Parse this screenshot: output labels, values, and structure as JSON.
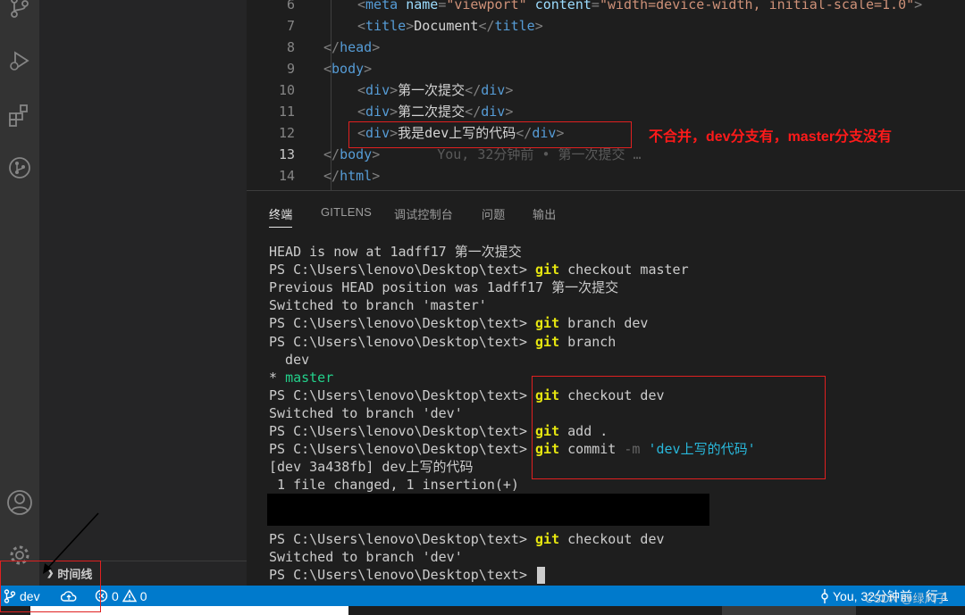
{
  "editor": {
    "lines": [
      {
        "num": "6",
        "parts": [
          [
            "pun",
            "<"
          ],
          [
            "tag",
            "meta "
          ],
          [
            "attr",
            "name"
          ],
          [
            "pun",
            "="
          ],
          [
            "str",
            "\"viewport\""
          ],
          [
            "txt",
            " "
          ],
          [
            "attr",
            "content"
          ],
          [
            "pun",
            "="
          ],
          [
            "str",
            "\"width=device-width, initial-scale=1.0\""
          ],
          [
            "pun",
            ">"
          ]
        ],
        "indent": 2
      },
      {
        "num": "7",
        "parts": [
          [
            "pun",
            "<"
          ],
          [
            "tag",
            "title"
          ],
          [
            "pun",
            ">"
          ],
          [
            "txt",
            "Document"
          ],
          [
            "pun",
            "</"
          ],
          [
            "tag",
            "title"
          ],
          [
            "pun",
            ">"
          ]
        ],
        "indent": 2
      },
      {
        "num": "8",
        "parts": [
          [
            "pun",
            "</"
          ],
          [
            "tag",
            "head"
          ],
          [
            "pun",
            ">"
          ]
        ],
        "indent": 1
      },
      {
        "num": "9",
        "parts": [
          [
            "pun",
            "<"
          ],
          [
            "tag",
            "body"
          ],
          [
            "pun",
            ">"
          ]
        ],
        "indent": 1
      },
      {
        "num": "10",
        "parts": [
          [
            "pun",
            "<"
          ],
          [
            "tag",
            "div"
          ],
          [
            "pun",
            ">"
          ],
          [
            "txt",
            "第一次提交"
          ],
          [
            "pun",
            "</"
          ],
          [
            "tag",
            "div"
          ],
          [
            "pun",
            ">"
          ]
        ],
        "indent": 2
      },
      {
        "num": "11",
        "parts": [
          [
            "pun",
            "<"
          ],
          [
            "tag",
            "div"
          ],
          [
            "pun",
            ">"
          ],
          [
            "txt",
            "第二次提交"
          ],
          [
            "pun",
            "</"
          ],
          [
            "tag",
            "div"
          ],
          [
            "pun",
            ">"
          ]
        ],
        "indent": 2
      },
      {
        "num": "12",
        "parts": [
          [
            "pun",
            "<"
          ],
          [
            "tag",
            "div"
          ],
          [
            "pun",
            ">"
          ],
          [
            "txt",
            "我是dev上写的代码"
          ],
          [
            "pun",
            "</"
          ],
          [
            "tag",
            "div"
          ],
          [
            "pun",
            ">"
          ]
        ],
        "indent": 2
      },
      {
        "num": "13",
        "parts": [
          [
            "pun",
            "</"
          ],
          [
            "tag",
            "body"
          ],
          [
            "pun",
            ">"
          ]
        ],
        "indent": 1,
        "blame": "You, 32分钟前 • 第一次提交 …"
      },
      {
        "num": "14",
        "parts": [
          [
            "pun",
            "</"
          ],
          [
            "tag",
            "html"
          ],
          [
            "pun",
            ">"
          ]
        ],
        "indent": 1
      }
    ]
  },
  "panel": {
    "tabs": [
      "终端",
      "GITLENS",
      "调试控制台",
      "问题",
      "输出"
    ],
    "active_tab": "终端",
    "prompt": "PS C:\\Users\\lenovo\\Desktop\\text> ",
    "terminal": [
      {
        "segs": [
          [
            "",
            "HEAD is now at 1adff17 第一次提交"
          ]
        ]
      },
      {
        "segs": [
          [
            "",
            "PS C:\\Users\\lenovo\\Desktop\\text> "
          ],
          [
            "gy",
            "git"
          ],
          [
            "",
            " checkout master"
          ]
        ]
      },
      {
        "segs": [
          [
            "",
            "Previous HEAD position was 1adff17 第一次提交"
          ]
        ]
      },
      {
        "segs": [
          [
            "",
            "Switched to branch 'master'"
          ]
        ]
      },
      {
        "segs": [
          [
            "",
            "PS C:\\Users\\lenovo\\Desktop\\text> "
          ],
          [
            "gy",
            "git"
          ],
          [
            "",
            " branch dev"
          ]
        ]
      },
      {
        "segs": [
          [
            "",
            "PS C:\\Users\\lenovo\\Desktop\\text> "
          ],
          [
            "gy",
            "git"
          ],
          [
            "",
            " branch"
          ]
        ]
      },
      {
        "segs": [
          [
            "",
            "  dev"
          ]
        ]
      },
      {
        "segs": [
          [
            "",
            "* "
          ],
          [
            "gr",
            "master"
          ]
        ]
      },
      {
        "segs": [
          [
            "",
            "PS C:\\Users\\lenovo\\Desktop\\text> "
          ],
          [
            "gy",
            "git"
          ],
          [
            "",
            " checkout dev"
          ]
        ]
      },
      {
        "segs": [
          [
            "",
            "Switched to branch 'dev'"
          ]
        ]
      },
      {
        "segs": [
          [
            "",
            "PS C:\\Users\\lenovo\\Desktop\\text> "
          ],
          [
            "gy",
            "git"
          ],
          [
            "",
            " add ."
          ]
        ]
      },
      {
        "segs": [
          [
            "",
            "PS C:\\Users\\lenovo\\Desktop\\text> "
          ],
          [
            "gy",
            "git"
          ],
          [
            "",
            " commit "
          ],
          [
            "gd",
            "-m"
          ],
          [
            "",
            " "
          ],
          [
            "gc",
            "'dev上写的代码'"
          ]
        ]
      },
      {
        "segs": [
          [
            "",
            "[dev 3a438fb] dev上写的代码"
          ]
        ]
      },
      {
        "segs": [
          [
            "",
            " 1 file changed, 1 insertion(+)"
          ]
        ]
      },
      {
        "segs": [
          [
            "",
            ""
          ]
        ]
      },
      {
        "segs": [
          [
            "",
            ""
          ]
        ]
      },
      {
        "segs": [
          [
            "",
            "PS C:\\Users\\lenovo\\Desktop\\text> "
          ],
          [
            "gy",
            "git"
          ],
          [
            "",
            " checkout dev"
          ]
        ]
      },
      {
        "segs": [
          [
            "",
            "Switched to branch 'dev'"
          ]
        ]
      },
      {
        "segs": [
          [
            "",
            "PS C:\\Users\\lenovo\\Desktop\\text> "
          ]
        ],
        "cursor": true
      }
    ]
  },
  "sidebar": {
    "timeline_label": "时间线"
  },
  "statusbar": {
    "branch": "dev",
    "errors": "0",
    "warnings": "0",
    "blame": "You, 32分钟前",
    "position": "行 1"
  },
  "annotation": {
    "note": "不合并，dev分支有，master分支没有"
  },
  "watermark": "CSDN @绿风子"
}
